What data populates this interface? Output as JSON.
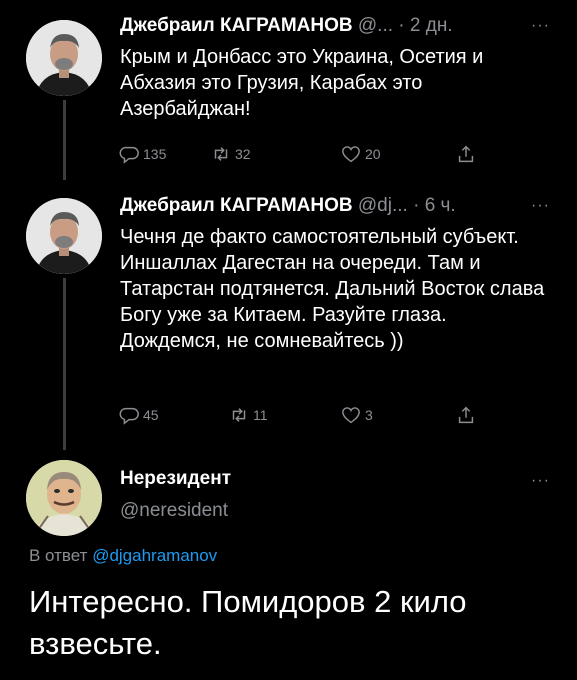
{
  "tweets": [
    {
      "name": "Джебраил КАГРАМАНОВ",
      "handle": "@...",
      "time": "2 дн.",
      "text": "Крым и Донбасс это Украина, Осетия и Абхазия это Грузия, Карабах это Азербайджан!",
      "replies": "135",
      "retweets": "32",
      "likes": "20"
    },
    {
      "name": "Джебраил КАГРАМАНОВ",
      "handle": "@dj...",
      "time": "6 ч.",
      "text": "Чечня де факто самостоятельный субъект. Иншаллах Дагестан на очереди. Там и Татарстан подтянется. Дальний Восток слава Богу уже за Китаем. Разуйте глаза. Дождемся, не сомневайтесь ))",
      "replies": "45",
      "retweets": "11",
      "likes": "3"
    }
  ],
  "reply": {
    "name": "Нерезидент",
    "handle": "@neresident",
    "reply_to_prefix": "В ответ",
    "reply_to_mention": "@djgahramanov",
    "text": "Интересно. Помидоров 2 кило взвесьте."
  },
  "more_glyph": "···",
  "dot": "·",
  "colors": {
    "background": "#000000",
    "secondary_text": "#8b8f94",
    "link": "#1d9bf0",
    "thread_line": "#3a3d41"
  }
}
